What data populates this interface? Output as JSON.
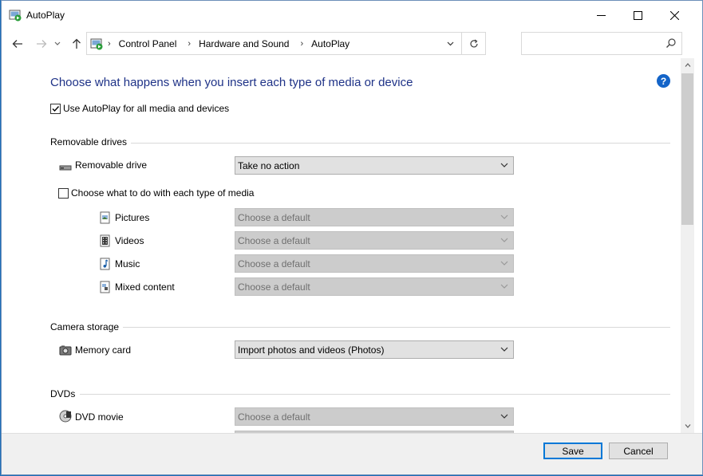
{
  "window": {
    "title": "AutoPlay",
    "icon": "autoplay-icon",
    "controls": [
      "minimize-icon",
      "maximize-icon",
      "close-icon"
    ]
  },
  "nav": {
    "breadcrumbs": [
      "Control Panel",
      "Hardware and Sound",
      "AutoPlay"
    ],
    "search_placeholder": ""
  },
  "content": {
    "heading": "Choose what happens when you insert each type of media or device",
    "use_autoplay": {
      "label": "Use AutoPlay for all media and devices",
      "checked": true
    },
    "sections": {
      "removable": {
        "title": "Removable drives",
        "drive_label": "Removable drive",
        "drive_value": "Take no action",
        "choose_each": {
          "label": "Choose what to do with each type of media",
          "checked": false
        },
        "media": [
          {
            "label": "Pictures",
            "value": "Choose a default"
          },
          {
            "label": "Videos",
            "value": "Choose a default"
          },
          {
            "label": "Music",
            "value": "Choose a default"
          },
          {
            "label": "Mixed content",
            "value": "Choose a default"
          }
        ]
      },
      "camera": {
        "title": "Camera storage",
        "label": "Memory card",
        "value": "Import photos and videos (Photos)"
      },
      "dvds": {
        "title": "DVDs",
        "label": "DVD movie",
        "value": "Choose a default"
      }
    }
  },
  "footer": {
    "save": "Save",
    "cancel": "Cancel"
  },
  "colors": {
    "heading": "#1e3287",
    "accent": "#0078d7",
    "help": "#1464c8"
  }
}
